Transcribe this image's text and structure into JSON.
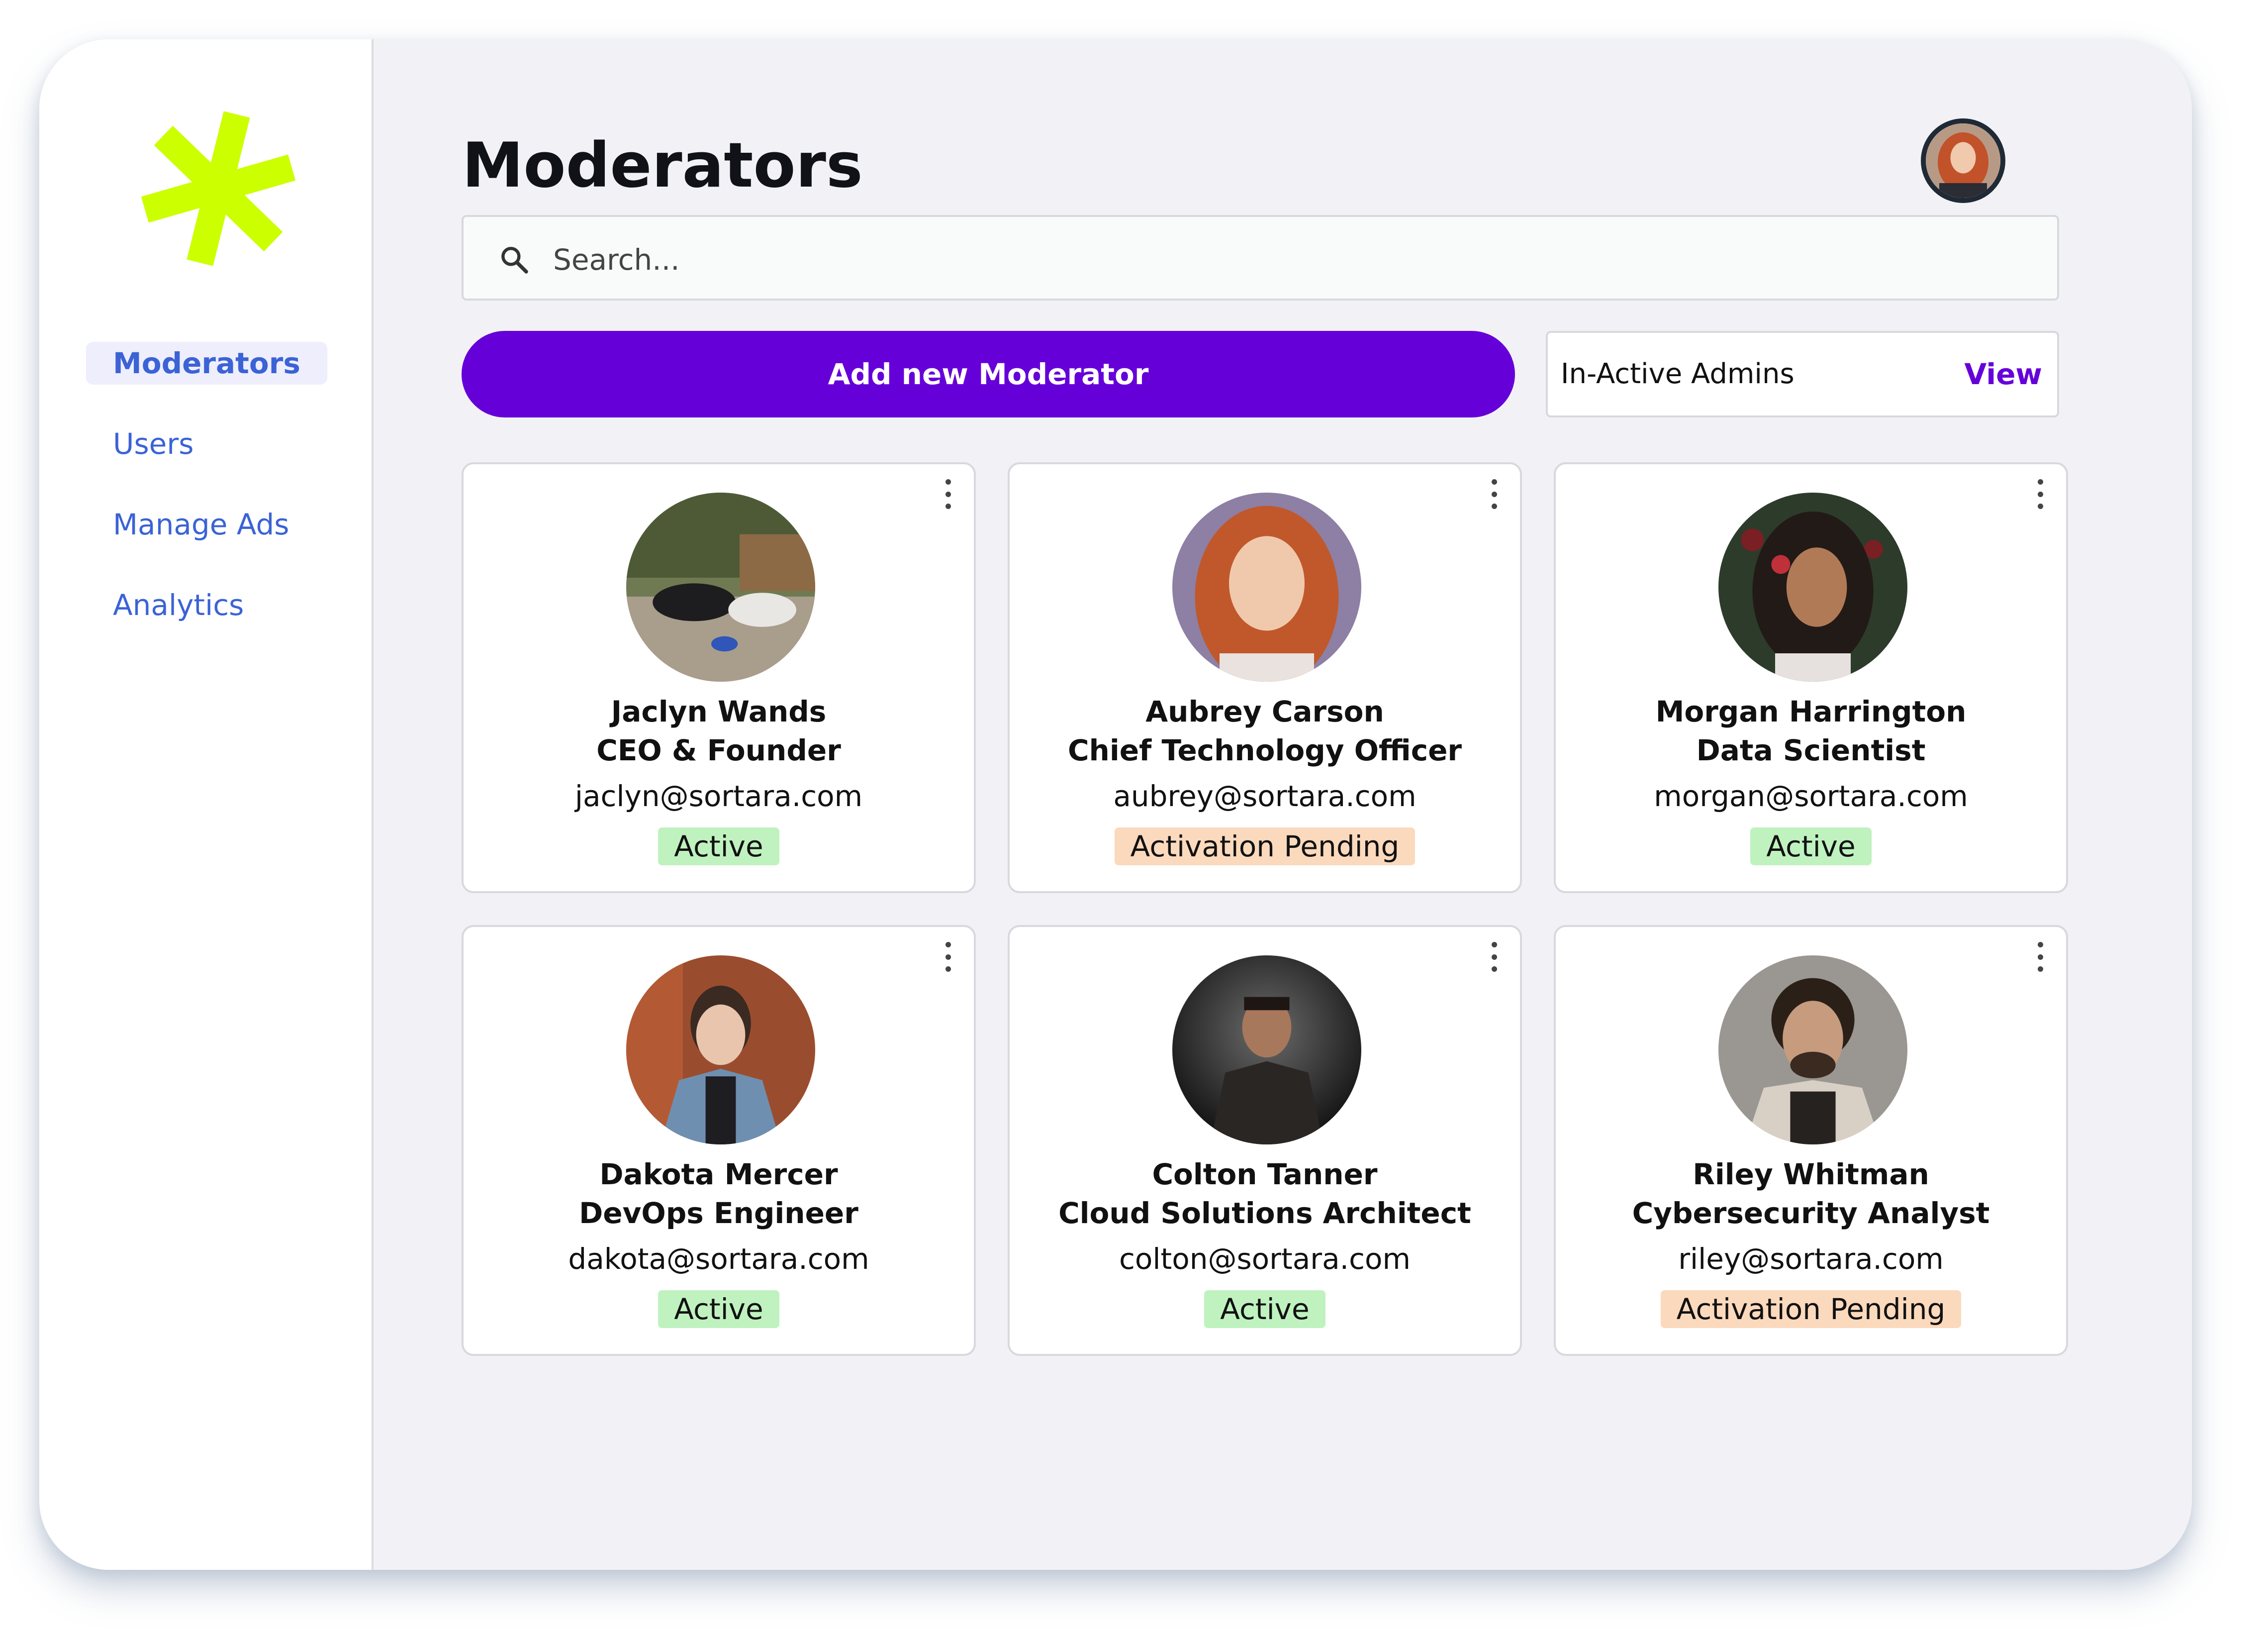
{
  "sidebar": {
    "items": [
      {
        "label": "Moderators",
        "active": true
      },
      {
        "label": "Users",
        "active": false
      },
      {
        "label": "Manage Ads",
        "active": false
      },
      {
        "label": "Analytics",
        "active": false
      }
    ]
  },
  "header": {
    "title": "Moderators"
  },
  "search": {
    "placeholder": "Search...",
    "value": ""
  },
  "actions": {
    "add_label": "Add new Moderator",
    "inactive_label": "In-Active Admins",
    "view_label": "View"
  },
  "colors": {
    "accent": "#6600d9",
    "nav_link": "#3b63d6",
    "logo": "#ccff00",
    "status_active": "#bff2bf",
    "status_pending": "#fbd9bd"
  },
  "cards": [
    {
      "name": "Jaclyn Wands",
      "role": "CEO & Founder",
      "email": "jaclyn@sortara.com",
      "status": "Active",
      "status_type": "active"
    },
    {
      "name": "Aubrey Carson",
      "role": "Chief Technology Officer",
      "email": "aubrey@sortara.com",
      "status": "Activation Pending",
      "status_type": "pending"
    },
    {
      "name": "Morgan Harrington",
      "role": "Data Scientist",
      "email": "morgan@sortara.com",
      "status": "Active",
      "status_type": "active"
    },
    {
      "name": "Dakota Mercer",
      "role": "DevOps Engineer",
      "email": "dakota@sortara.com",
      "status": "Active",
      "status_type": "active"
    },
    {
      "name": "Colton Tanner",
      "role": "Cloud Solutions Architect",
      "email": "colton@sortara.com",
      "status": "Active",
      "status_type": "active"
    },
    {
      "name": "Riley Whitman",
      "role": "Cybersecurity Analyst",
      "email": "riley@sortara.com",
      "status": "Activation Pending",
      "status_type": "pending"
    }
  ]
}
